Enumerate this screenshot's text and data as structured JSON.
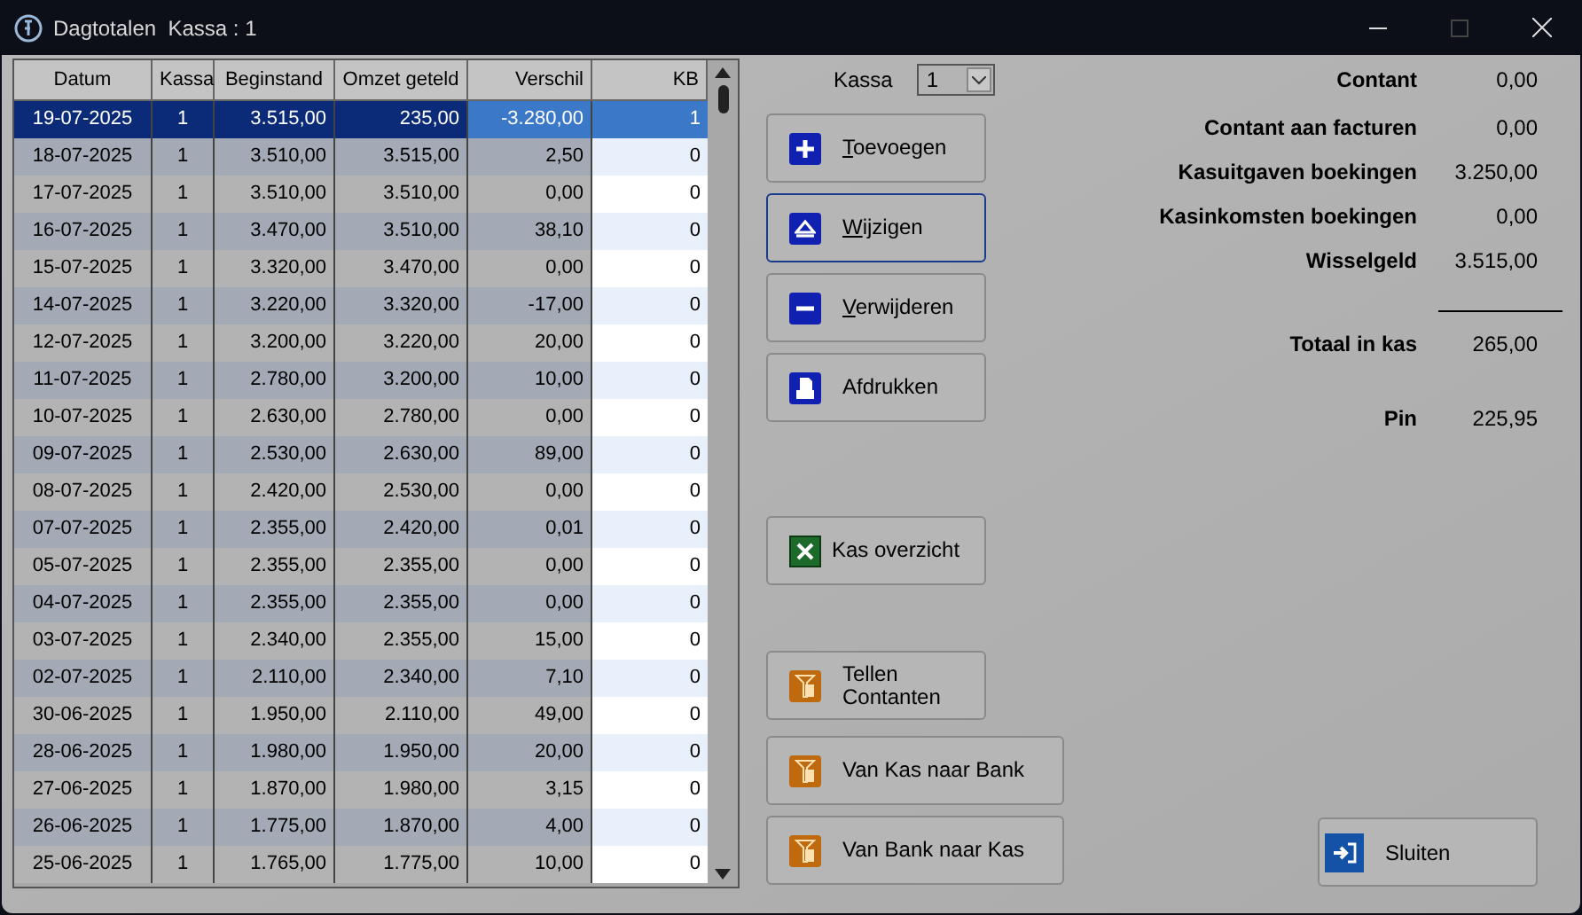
{
  "window": {
    "title": "Dagtotalen  Kassa : 1"
  },
  "table": {
    "columns": [
      "Datum",
      "Kassa",
      "Beginstand",
      "Omzet geteld",
      "Verschil",
      "KB"
    ],
    "rows": [
      {
        "cells": [
          "19-07-2025",
          "1",
          "3.515,00",
          "235,00",
          "-3.280,00",
          "1"
        ],
        "selected": true
      },
      {
        "cells": [
          "18-07-2025",
          "1",
          "3.510,00",
          "3.515,00",
          "2,50",
          "0"
        ],
        "selected": false
      },
      {
        "cells": [
          "17-07-2025",
          "1",
          "3.510,00",
          "3.510,00",
          "0,00",
          "0"
        ],
        "selected": false
      },
      {
        "cells": [
          "16-07-2025",
          "1",
          "3.470,00",
          "3.510,00",
          "38,10",
          "0"
        ],
        "selected": false
      },
      {
        "cells": [
          "15-07-2025",
          "1",
          "3.320,00",
          "3.470,00",
          "0,00",
          "0"
        ],
        "selected": false
      },
      {
        "cells": [
          "14-07-2025",
          "1",
          "3.220,00",
          "3.320,00",
          "-17,00",
          "0"
        ],
        "selected": false
      },
      {
        "cells": [
          "12-07-2025",
          "1",
          "3.200,00",
          "3.220,00",
          "20,00",
          "0"
        ],
        "selected": false
      },
      {
        "cells": [
          "11-07-2025",
          "1",
          "2.780,00",
          "3.200,00",
          "10,00",
          "0"
        ],
        "selected": false
      },
      {
        "cells": [
          "10-07-2025",
          "1",
          "2.630,00",
          "2.780,00",
          "0,00",
          "0"
        ],
        "selected": false
      },
      {
        "cells": [
          "09-07-2025",
          "1",
          "2.530,00",
          "2.630,00",
          "89,00",
          "0"
        ],
        "selected": false
      },
      {
        "cells": [
          "08-07-2025",
          "1",
          "2.420,00",
          "2.530,00",
          "0,00",
          "0"
        ],
        "selected": false
      },
      {
        "cells": [
          "07-07-2025",
          "1",
          "2.355,00",
          "2.420,00",
          "0,01",
          "0"
        ],
        "selected": false
      },
      {
        "cells": [
          "05-07-2025",
          "1",
          "2.355,00",
          "2.355,00",
          "0,00",
          "0"
        ],
        "selected": false
      },
      {
        "cells": [
          "04-07-2025",
          "1",
          "2.355,00",
          "2.355,00",
          "0,00",
          "0"
        ],
        "selected": false
      },
      {
        "cells": [
          "03-07-2025",
          "1",
          "2.340,00",
          "2.355,00",
          "15,00",
          "0"
        ],
        "selected": false
      },
      {
        "cells": [
          "02-07-2025",
          "1",
          "2.110,00",
          "2.340,00",
          "7,10",
          "0"
        ],
        "selected": false
      },
      {
        "cells": [
          "30-06-2025",
          "1",
          "1.950,00",
          "2.110,00",
          "49,00",
          "0"
        ],
        "selected": false
      },
      {
        "cells": [
          "28-06-2025",
          "1",
          "1.980,00",
          "1.950,00",
          "20,00",
          "0"
        ],
        "selected": false
      },
      {
        "cells": [
          "27-06-2025",
          "1",
          "1.870,00",
          "1.980,00",
          "3,15",
          "0"
        ],
        "selected": false
      },
      {
        "cells": [
          "26-06-2025",
          "1",
          "1.775,00",
          "1.870,00",
          "4,00",
          "0"
        ],
        "selected": false
      },
      {
        "cells": [
          "25-06-2025",
          "1",
          "1.765,00",
          "1.775,00",
          "10,00",
          "0"
        ],
        "selected": false
      }
    ]
  },
  "kassa_selector": {
    "label": "Kassa",
    "value": "1"
  },
  "buttons": [
    {
      "label": "Toevoegen",
      "kind": "add",
      "underline_first": true,
      "focused": false
    },
    {
      "label": "Wijzigen",
      "kind": "edit",
      "underline_first": true,
      "focused": true
    },
    {
      "label": "Verwijderen",
      "kind": "remove",
      "underline_first": true,
      "focused": false
    },
    {
      "label": "Afdrukken",
      "kind": "print",
      "underline_first": false,
      "focused": false
    },
    {
      "label": "Kas overzicht",
      "kind": "excel",
      "underline_first": false,
      "focused": false
    },
    {
      "label": "Tellen\nContanten",
      "kind": "transfer",
      "underline_first": false,
      "focused": false
    },
    {
      "label": "Van Kas naar Bank",
      "kind": "transfer",
      "underline_first": false,
      "focused": false
    },
    {
      "label": "Van Bank naar Kas",
      "kind": "transfer",
      "underline_first": false,
      "focused": false
    }
  ],
  "summary": [
    {
      "label": "Contant",
      "value": "0,00"
    },
    {
      "label": "Contant aan facturen",
      "value": "0,00"
    },
    {
      "label": "Kasuitgaven boekingen",
      "value": "3.250,00"
    },
    {
      "label": "Kasinkomsten boekingen",
      "value": "0,00"
    },
    {
      "label": "Wisselgeld",
      "value": "3.515,00"
    },
    {
      "label": "Totaal in kas",
      "value": "265,00",
      "kind": "total"
    },
    {
      "label": "Pin",
      "value": "225,95",
      "kind": "pin"
    }
  ],
  "close_button": {
    "label": "Sluiten"
  }
}
